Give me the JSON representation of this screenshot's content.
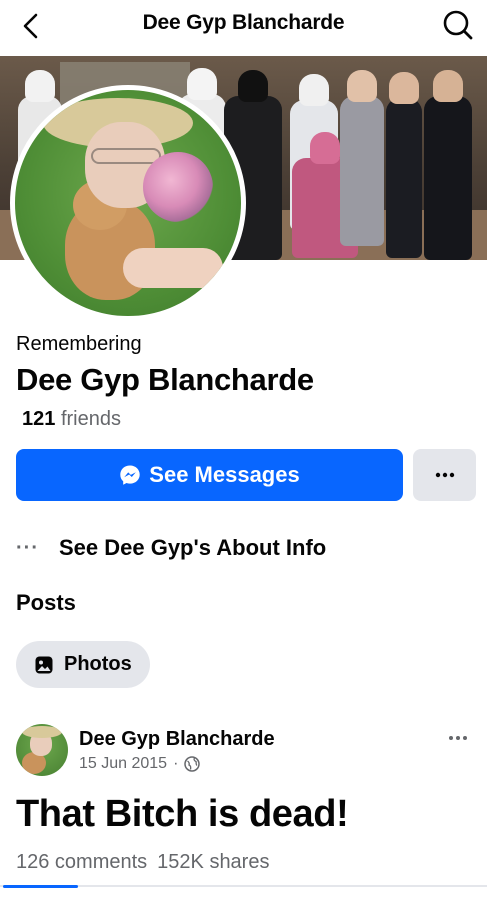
{
  "topbar": {
    "title": "Dee Gyp Blancharde",
    "back_icon": "chevron-left-icon",
    "search_icon": "search-icon"
  },
  "profile": {
    "status": "Remembering",
    "name": "Dee Gyp Blancharde",
    "friends_count": "121",
    "friends_label": "friends"
  },
  "actions": {
    "messages_label": "See Messages",
    "messages_icon": "messenger-icon",
    "more_icon": "more-horizontal-icon"
  },
  "about": {
    "dots": "···",
    "label": "See Dee Gyp's About Info"
  },
  "posts": {
    "heading": "Posts",
    "photos_chip": "Photos"
  },
  "post": {
    "author": "Dee Gyp Blancharde",
    "date": "15 Jun 2015",
    "separator": "·",
    "privacy_icon": "globe-icon",
    "text": "That Bitch is dead!",
    "comments": "126 comments",
    "shares": "152K shares"
  },
  "colors": {
    "accent": "#0866ff",
    "secondary_button": "#e4e6eb",
    "muted_text": "#65676b"
  }
}
